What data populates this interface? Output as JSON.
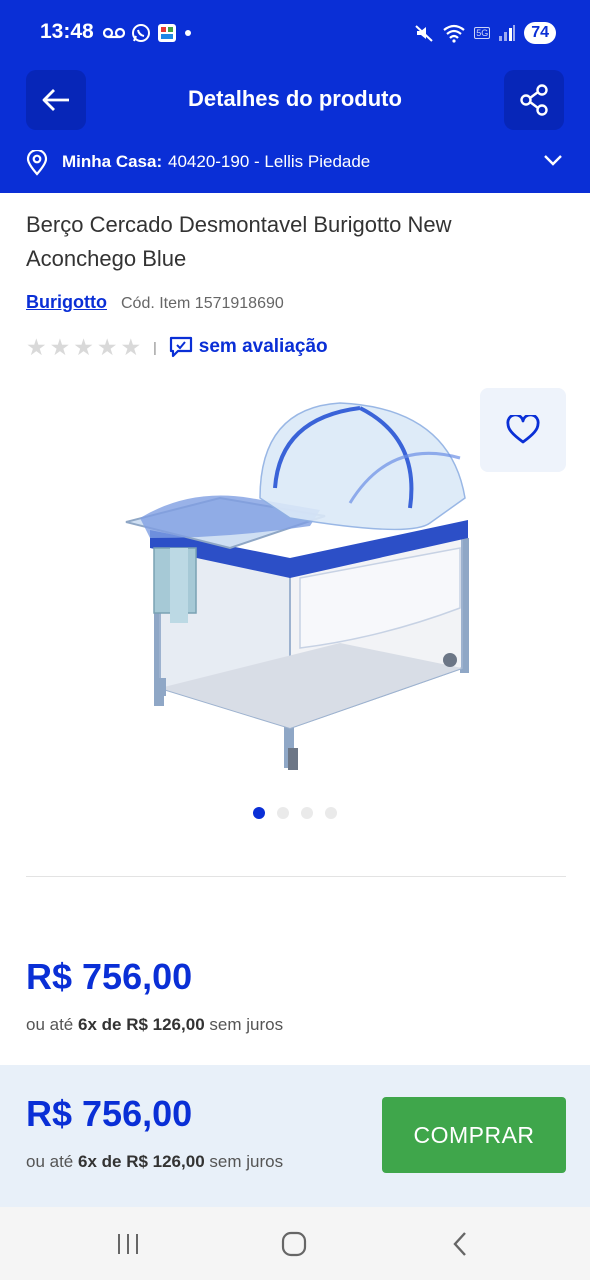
{
  "status_bar": {
    "time": "13:48",
    "battery": "74",
    "network": "5G",
    "icons": [
      "voicemail-icon",
      "whatsapp-icon",
      "app-notification-icon",
      "dot-icon",
      "mute-icon",
      "wifi-icon",
      "signal-icon",
      "battery-icon"
    ]
  },
  "header": {
    "title": "Detalhes do produto",
    "back_icon": "arrow-left-icon",
    "share_icon": "share-icon"
  },
  "location": {
    "label": "Minha Casa:",
    "value": "40420-190 - Lellis Piedade"
  },
  "product": {
    "title": "Berço Cercado Desmontavel Burigotto New Aconchego Blue",
    "brand": "Burigotto",
    "item_code": "Cód. Item 1571918690",
    "rating_label": "sem avaliação",
    "rating_stars": 0,
    "rating_max": 5,
    "image_count": 4,
    "active_image": 1
  },
  "price": {
    "main": "R$ 756,00",
    "installment_prefix": "ou até",
    "installment_value": "6x de R$ 126,00",
    "installment_suffix": "sem juros"
  },
  "sticky": {
    "price": "R$ 756,00",
    "installment_prefix": "ou até",
    "installment_value": "6x de R$ 126,00",
    "installment_suffix": "sem juros",
    "buy_label": "COMPRAR"
  },
  "colors": {
    "brand_blue": "#0a2fd6",
    "buy_green": "#3fa64b",
    "sticky_bg": "#e8f0f9"
  }
}
